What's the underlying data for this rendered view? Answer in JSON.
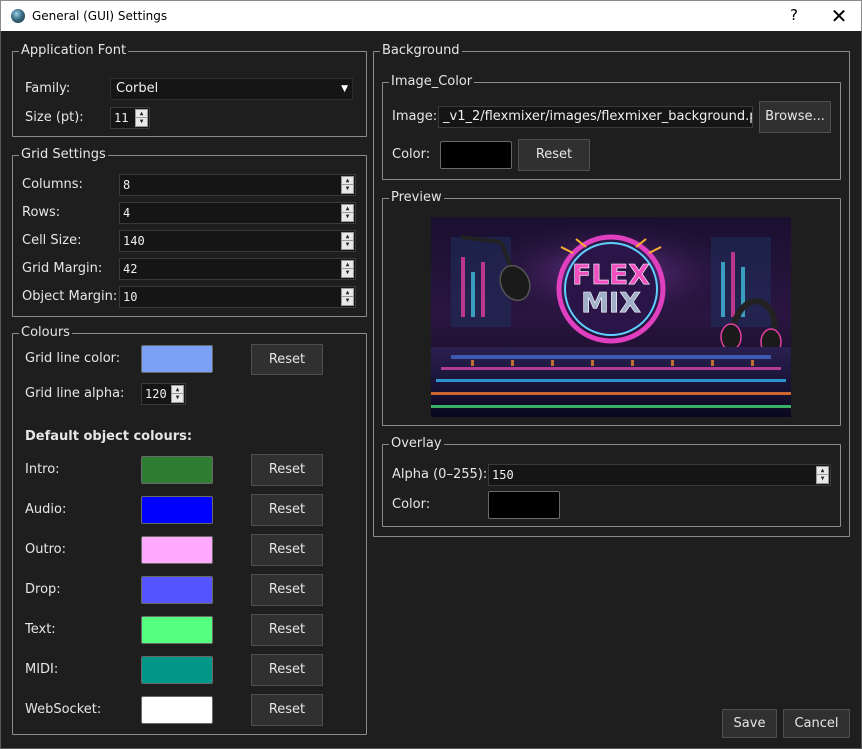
{
  "window": {
    "title": "General (GUI) Settings",
    "help_label": "?",
    "close_label": "✕"
  },
  "application_font": {
    "legend": "Application Font",
    "family_label": "Family:",
    "family_value": "Corbel",
    "size_label": "Size (pt):",
    "size_value": "11"
  },
  "grid_settings": {
    "legend": "Grid Settings",
    "fields": [
      {
        "label": "Columns:",
        "value": "8"
      },
      {
        "label": "Rows:",
        "value": "4"
      },
      {
        "label": "Cell Size:",
        "value": "140"
      },
      {
        "label": "Grid Margin:",
        "value": "42"
      },
      {
        "label": "Object Margin:",
        "value": "10"
      }
    ]
  },
  "colours": {
    "legend": "Colours",
    "grid_line_color_label": "Grid line color:",
    "grid_line_color": "#7ba1f7",
    "grid_line_alpha_label": "Grid line alpha:",
    "grid_line_alpha_value": "120",
    "reset_label": "Reset",
    "default_heading": "Default object colours:",
    "objects": [
      {
        "label": "Intro:",
        "color": "#2e7d32"
      },
      {
        "label": "Audio:",
        "color": "#0000ff"
      },
      {
        "label": "Outro:",
        "color": "#ffaaff"
      },
      {
        "label": "Drop:",
        "color": "#5555ff"
      },
      {
        "label": "Text:",
        "color": "#55ff7f"
      },
      {
        "label": "MIDI:",
        "color": "#009688"
      },
      {
        "label": "WebSocket:",
        "color": "#ffffff"
      }
    ]
  },
  "background": {
    "legend": "Background",
    "image_color": {
      "legend": "Image_Color",
      "image_label": "Image:",
      "image_path": "_v1_2/flexmixer/images/flexmixer_background.png",
      "browse_label": "Browse...",
      "color_label": "Color:",
      "color_value": "#000000",
      "reset_label": "Reset"
    },
    "preview": {
      "legend": "Preview",
      "logo_line1": "FLEX",
      "logo_line2": "MIX"
    },
    "overlay": {
      "legend": "Overlay",
      "alpha_label": "Alpha (0–255):",
      "alpha_value": "150",
      "color_label": "Color:",
      "color_value": "#000000"
    }
  },
  "footer": {
    "save_label": "Save",
    "cancel_label": "Cancel"
  }
}
